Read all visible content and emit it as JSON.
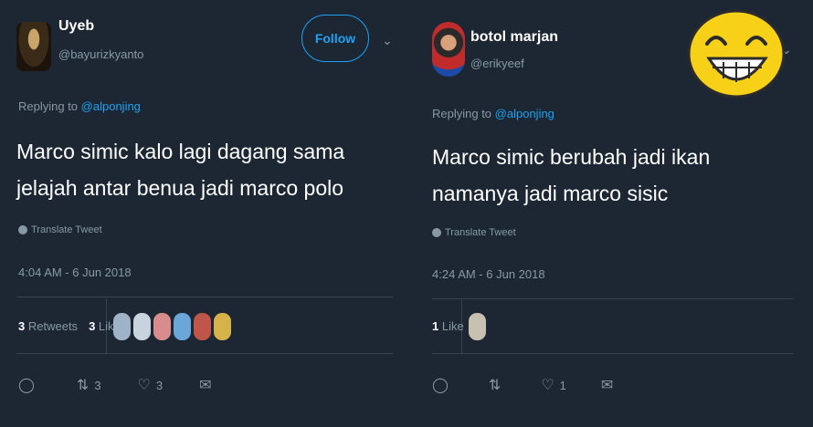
{
  "tweets": [
    {
      "name": "Uyeb",
      "handle": "@bayurizkyanto",
      "follow_label": "Follow",
      "replying_prefix": "Replying to",
      "replying_to": "@alponjing",
      "text": "Marco simic kalo lagi dagang sama jelajah antar benua jadi marco polo",
      "translate_label": "Translate Tweet",
      "timestamp": "4:04 AM - 6 Jun 2018",
      "retweets_count": "3",
      "retweets_label": "Retweets",
      "likes_count": "3",
      "likes_label": "Likes",
      "actions": {
        "reply_count": "",
        "retweet_count": "3",
        "like_count": "3"
      },
      "likers": [
        {
          "icon": "user-avatar",
          "color": "#9fb3c8"
        },
        {
          "icon": "user-avatar",
          "color": "#c9d3dd"
        },
        {
          "icon": "user-avatar",
          "color": "#d98c8c"
        },
        {
          "icon": "user-avatar",
          "color": "#6aa6d8"
        },
        {
          "icon": "user-avatar",
          "color": "#c0554a"
        },
        {
          "icon": "user-avatar",
          "color": "#d6b34a"
        }
      ]
    },
    {
      "name": "botol marjan",
      "handle": "@erikyeef",
      "replying_prefix": "Replying to",
      "replying_to": "@alponjing",
      "text": "Marco simic berubah jadi ikan namanya jadi marco sisic",
      "translate_label": "Translate Tweet",
      "timestamp": "4:24 AM - 6 Jun 2018",
      "likes_count": "1",
      "likes_label": "Like",
      "actions": {
        "reply_count": "",
        "retweet_count": "",
        "like_count": "1"
      },
      "likers": [
        {
          "icon": "user-avatar",
          "color": "#c8c0b0"
        }
      ]
    }
  ],
  "overlay": {
    "icon": "laughing-emoji",
    "color": "#f7d117"
  },
  "colors": {
    "background": "#1d2733",
    "accent": "#1da1f2",
    "muted": "#8899a6"
  }
}
